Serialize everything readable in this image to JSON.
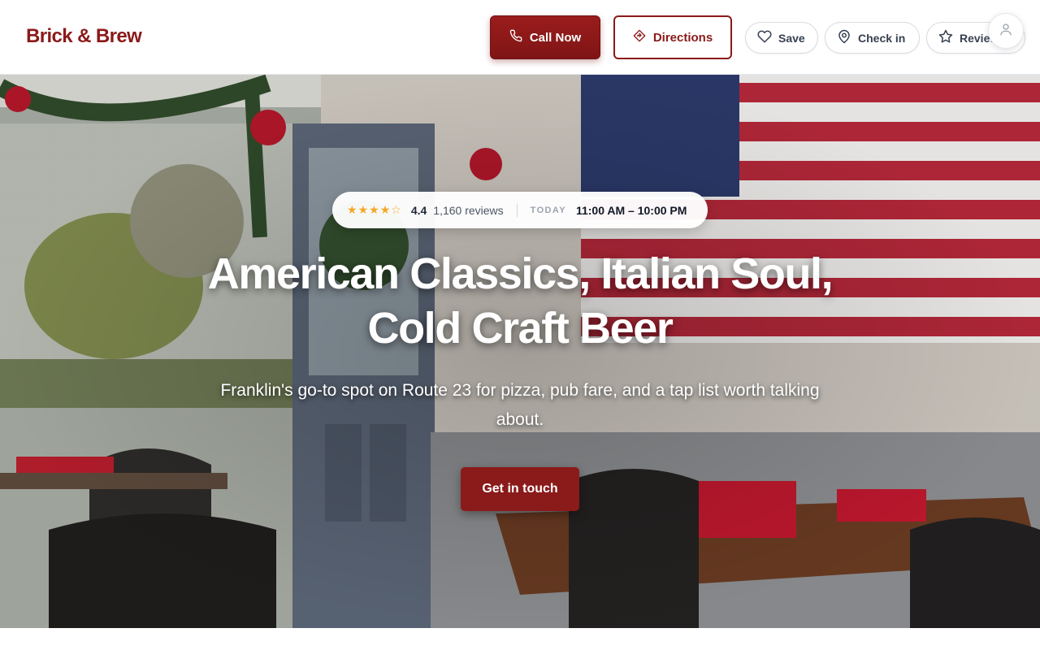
{
  "header": {
    "brand": "Brick & Brew",
    "call_label": "Call Now",
    "directions_label": "Directions",
    "save_label": "Save",
    "checkin_label": "Check in",
    "review_label": "Review",
    "icons": {
      "call": "phone-icon",
      "directions": "directions-icon",
      "save": "heart-icon",
      "checkin": "map-pin-icon",
      "review": "star-icon",
      "account": "user-icon"
    }
  },
  "hero": {
    "rating": "4.4",
    "rating_value": 4.4,
    "reviews": "1,160 reviews",
    "today_label": "TODAY",
    "hours": "11:00 AM – 10:00 PM",
    "headline_line1": "American Classics, Italian Soul,",
    "headline_line2": "Cold Craft Beer",
    "subheadline": "Franklin's go-to spot on Route 23 for pizza, pub fare, and a tap list worth talking about.",
    "cta_label": "Get in touch"
  },
  "colors": {
    "brand": "#8b1a1a",
    "star": "#f5a623"
  }
}
